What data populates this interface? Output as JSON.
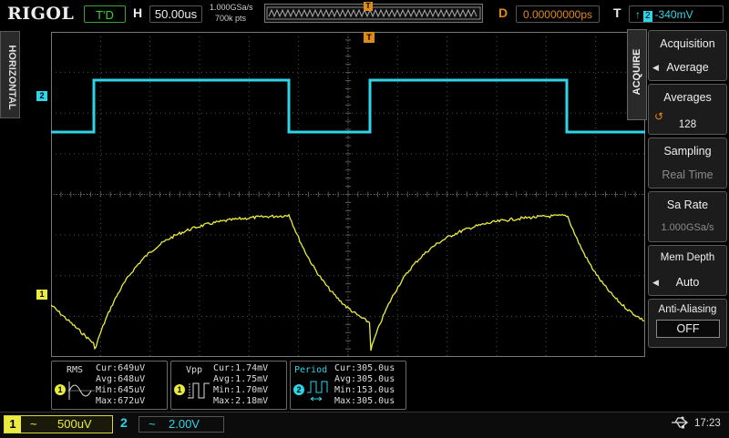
{
  "top_bar": {
    "logo": "RIGOL",
    "run_status": "T'D",
    "timebase_label": "H",
    "timebase_value": "50.00us",
    "sample_rate": "1.000GSa/s",
    "memory_points": "700k pts",
    "trigger_position_marker": "T",
    "delay_label": "D",
    "delay_value": "0.00000000ps",
    "trigger_label": "T",
    "trigger_edge": "rising",
    "trigger_source": "2",
    "trigger_level": "-340mV"
  },
  "left_tab": {
    "label": "HORIZONTAL"
  },
  "right_menu": {
    "tab_label": "ACQUIRE",
    "items": [
      {
        "title": "Acquisition",
        "value": "Average"
      },
      {
        "title": "Averages",
        "value": "128"
      },
      {
        "title": "Sampling",
        "value": "Real Time"
      },
      {
        "title": "Sa Rate",
        "value": "1.000GSa/s"
      },
      {
        "title": "Mem Depth",
        "value": "Auto"
      },
      {
        "title": "Anti-Aliasing",
        "value": "OFF"
      }
    ]
  },
  "channel_markers": {
    "ch1": "1",
    "ch2": "2"
  },
  "measurements": [
    {
      "name": "RMS",
      "channel": "1",
      "cur": "Cur:649uV",
      "avg": "Avg:648uV",
      "min": "Min:645uV",
      "max": "Max:672uV"
    },
    {
      "name": "Vpp",
      "channel": "1",
      "cur": "Cur:1.74mV",
      "avg": "Avg:1.75mV",
      "min": "Min:1.70mV",
      "max": "Max:2.18mV"
    },
    {
      "name": "Period",
      "channel": "2",
      "cur": "Cur:305.0us",
      "avg": "Avg:305.0us",
      "min": "Min:153.0us",
      "max": "Max:305.0us"
    }
  ],
  "bottom_bar": {
    "ch1_number": "1",
    "ch1_coupling": "~",
    "ch1_scale": "500uV",
    "ch2_number": "2",
    "ch2_coupling": "~",
    "ch2_scale": "2.00V",
    "time": "17:23"
  },
  "colors": {
    "ch1": "#ecec40",
    "ch2": "#2ed5e8",
    "trigger": "#e08a1a",
    "grid": "#555555"
  }
}
